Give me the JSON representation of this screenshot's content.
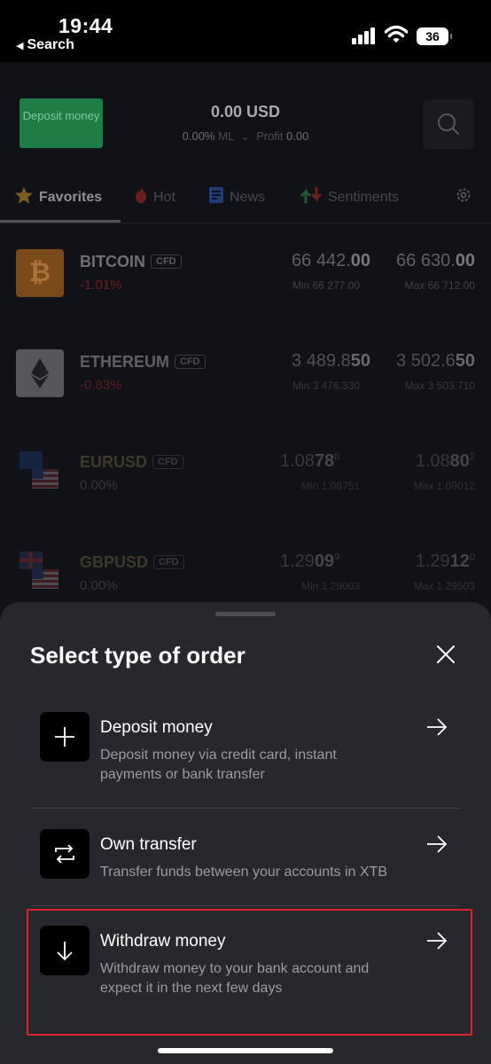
{
  "status_bar": {
    "time": "19:44",
    "back_label": "Search",
    "battery": "36"
  },
  "header": {
    "deposit_button": "Deposit money",
    "balance": "0.00 USD",
    "ml_value": "0.00%",
    "ml_label": "ML",
    "profit_label": "Profit",
    "profit_value": "0.00"
  },
  "tabs": [
    {
      "label": "Favorites",
      "icon": "star-icon",
      "color": "#d8a222"
    },
    {
      "label": "Hot",
      "icon": "flame-icon",
      "color": "#e0332f"
    },
    {
      "label": "News",
      "icon": "news-icon",
      "color": "#2d6de0"
    },
    {
      "label": "Sentiments",
      "icon": "sentiment-arrows-icon",
      "color": "#28a55a"
    }
  ],
  "assets": [
    {
      "name": "BITCOIN",
      "badge": "CFD",
      "change": "-1.01%",
      "sell_main": "66 442.",
      "sell_big": "00",
      "sell_sub": "Min 66 277.00",
      "buy_main": "66 630.",
      "buy_big": "00",
      "buy_sub": "Max 66 712.00"
    },
    {
      "name": "ETHEREUM",
      "badge": "CFD",
      "change": "-0.83%",
      "sell_main": "3 489.8",
      "sell_big": "50",
      "sell_sub": "Min 3 476.330",
      "buy_main": "3 502.6",
      "buy_big": "50",
      "buy_sub": "Max 3 503.710"
    },
    {
      "name": "EURUSD",
      "badge": "CFD",
      "change": "0.00%",
      "sell_main": "1.08",
      "sell_big": "78",
      "sell_sup": "8",
      "sell_sub": "Min 1.08751",
      "buy_main": "1.08",
      "buy_big": "80",
      "buy_sup": "2",
      "buy_sub": "Max 1.09012"
    },
    {
      "name": "GBPUSD",
      "badge": "CFD",
      "change": "0.00%",
      "sell_main": "1.29",
      "sell_big": "09",
      "sell_sup": "9",
      "sell_sub": "Min 1.29003",
      "buy_main": "1.29",
      "buy_big": "12",
      "buy_sup": "0",
      "buy_sub": "Max 1.29503"
    }
  ],
  "sheet": {
    "title": "Select type of order",
    "options": [
      {
        "title": "Deposit money",
        "desc": "Deposit money via credit card, instant payments or bank transfer",
        "icon": "plus-icon"
      },
      {
        "title": "Own transfer",
        "desc": "Transfer funds between your accounts in XTB",
        "icon": "transfer-icon"
      },
      {
        "title": "Withdraw money",
        "desc": "Withdraw money to your bank account and expect it in the next few days",
        "icon": "arrow-down-icon"
      }
    ],
    "highlight_color": "#e0212a"
  }
}
